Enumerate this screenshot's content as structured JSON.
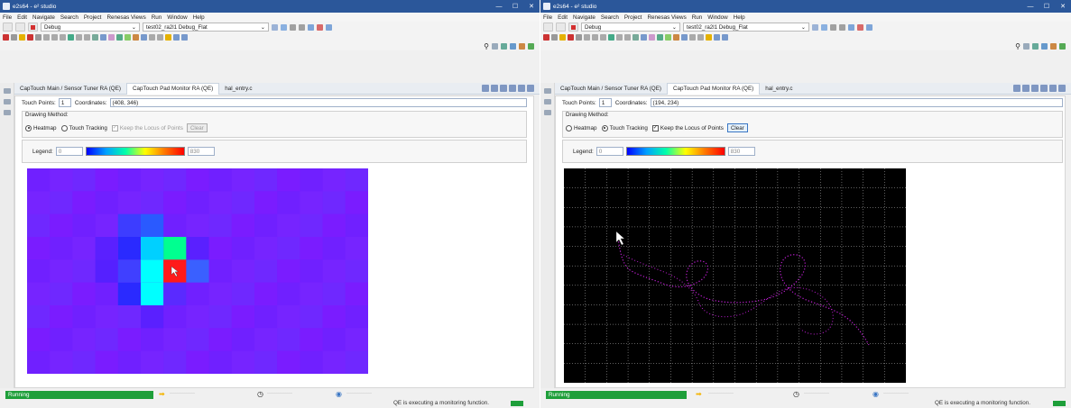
{
  "left": {
    "window_title": "e2s64 - e² studio",
    "menu": [
      "File",
      "Edit",
      "Navigate",
      "Search",
      "Project",
      "Renesas Views",
      "Run",
      "Window",
      "Help"
    ],
    "debug_combo": "Debug",
    "config_combo": "test02_ra2l1 Debug_Flat",
    "tabs": [
      "CapTouch Main / Sensor Tuner RA (QE)",
      "CapTouch Pad Monitor RA (QE)",
      "hal_entry.c"
    ],
    "touch_points_label": "Touch Points:",
    "touch_points_value": "1",
    "coordinates_label": "Coordinates:",
    "coordinates_value": "(408, 346)",
    "drawing_method_label": "Drawing Method:",
    "radio_heatmap": "Heatmap",
    "radio_tracking": "Touch Tracking",
    "keep_locus": "Keep the Locus of Points",
    "clear": "Clear",
    "legend_label": "Legend:",
    "legend_min": "0",
    "legend_max": "830",
    "status_running": "Running",
    "status_msg": "QE is executing a monitoring function."
  },
  "right": {
    "window_title": "e2s64 - e² studio",
    "menu": [
      "File",
      "Edit",
      "Navigate",
      "Search",
      "Project",
      "Renesas Views",
      "Run",
      "Window",
      "Help"
    ],
    "debug_combo": "Debug",
    "config_combo": "test02_ra2l1 Debug_Flat",
    "tabs": [
      "CapTouch Main / Sensor Tuner RA (QE)",
      "CapTouch Pad Monitor RA (QE)",
      "hal_entry.c"
    ],
    "touch_points_label": "Touch Points:",
    "touch_points_value": "1",
    "coordinates_label": "Coordinates:",
    "coordinates_value": "(194, 234)",
    "drawing_method_label": "Drawing Method:",
    "radio_heatmap": "Heatmap",
    "radio_tracking": "Touch Tracking",
    "keep_locus": "Keep the Locus of Points",
    "clear": "Clear",
    "legend_label": "Legend:",
    "legend_min": "0",
    "legend_max": "830",
    "status_running": "Running",
    "status_msg": "QE is executing a monitoring function."
  },
  "colors": {
    "titlebar": "#2b579a",
    "heatmap_bg": "#7a1cff",
    "running": "#1e9f3a",
    "track_bg": "#000000",
    "track_path": "#c21fd6"
  },
  "heatmap": {
    "grid_cols": 15,
    "grid_rows": 9,
    "hot_cells": [
      {
        "c": 4,
        "r": 2,
        "color": "#3d3dff"
      },
      {
        "c": 5,
        "r": 2,
        "color": "#2a5aff"
      },
      {
        "c": 4,
        "r": 3,
        "color": "#2a2aff"
      },
      {
        "c": 5,
        "r": 3,
        "color": "#00d0ff"
      },
      {
        "c": 6,
        "r": 3,
        "color": "#00ff90"
      },
      {
        "c": 5,
        "r": 4,
        "color": "#00ffff"
      },
      {
        "c": 6,
        "r": 4,
        "color": "#ff1a1a"
      },
      {
        "c": 7,
        "r": 4,
        "color": "#3a60ff"
      },
      {
        "c": 5,
        "r": 5,
        "color": "#00ffff"
      },
      {
        "c": 4,
        "r": 5,
        "color": "#2a2aff"
      },
      {
        "c": 6,
        "r": 5,
        "color": "#5a2aff"
      },
      {
        "c": 3,
        "r": 3,
        "color": "#5a20ff"
      },
      {
        "c": 3,
        "r": 4,
        "color": "#5520ff"
      },
      {
        "c": 7,
        "r": 3,
        "color": "#5a20ff"
      },
      {
        "c": 4,
        "r": 4,
        "color": "#4040ff"
      },
      {
        "c": 5,
        "r": 6,
        "color": "#5a20ff"
      }
    ]
  }
}
